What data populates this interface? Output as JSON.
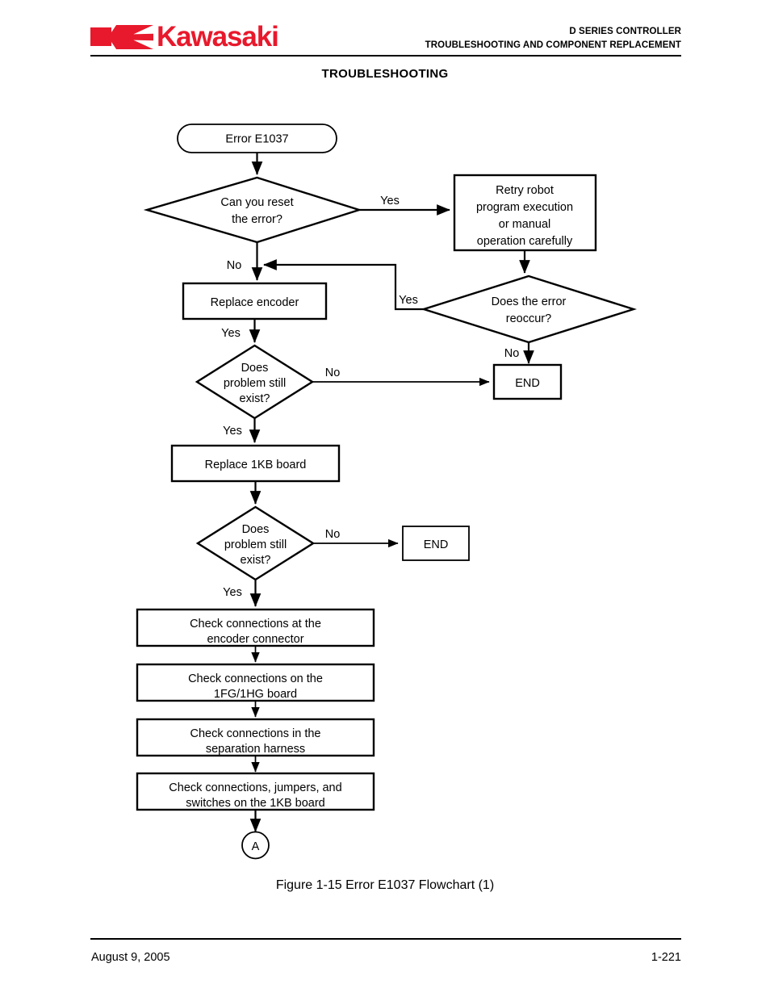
{
  "header": {
    "logo_text": "Kawasaki",
    "doc_title_line1": "D SERIES CONTROLLER",
    "doc_title_line2": "TROUBLESHOOTING AND COMPONENT REPLACEMENT",
    "section_title": "TROUBLESHOOTING",
    "brand_color": "#e8192c"
  },
  "flowchart": {
    "nodes": {
      "start": "Error E1037",
      "decision_reset": "Can you reset\nthe error?",
      "decision_reset_l1": "Can you reset",
      "decision_reset_l2": "the error?",
      "retry_l1": "Retry robot",
      "retry_l2": "program execution",
      "retry_l3": "or manual",
      "retry_l4": "operation carefully",
      "decision_reoccur_l1": "Does the error",
      "decision_reoccur_l2": "reoccur?",
      "end_1": "END",
      "replace_encoder": "Replace encoder",
      "decision_problem1_l1": "Does",
      "decision_problem1_l2": "problem still",
      "decision_problem1_l3": "exist?",
      "replace_board": "Replace 1KB board",
      "decision_problem2_l1": "Does",
      "decision_problem2_l2": "problem still",
      "decision_problem2_l3": "exist?",
      "end_2": "END",
      "check_encoder_l1": "Check connections at the",
      "check_encoder_l2": "encoder connector",
      "check_1fg_l1": "Check connections on the",
      "check_1fg_l2": "1FG/1HG board",
      "check_harness_l1": "Check connections in the",
      "check_harness_l2": "separation harness",
      "check_1kb_l1": "Check connections, jumpers, and",
      "check_1kb_l2": "switches on the 1KB board",
      "connector_a": "A"
    },
    "edge_labels": {
      "reset_yes": "Yes",
      "reset_no": "No",
      "reoccur_yes": "Yes",
      "reoccur_no": "No",
      "encoder_yes": "Yes",
      "problem1_no": "No",
      "problem1_yes": "Yes",
      "problem2_no": "No",
      "problem2_yes": "Yes"
    }
  },
  "caption": "Figure 1-15  Error E1037 Flowchart (1)",
  "footer": {
    "date": "August 9, 2005",
    "page_number": "1-221"
  }
}
